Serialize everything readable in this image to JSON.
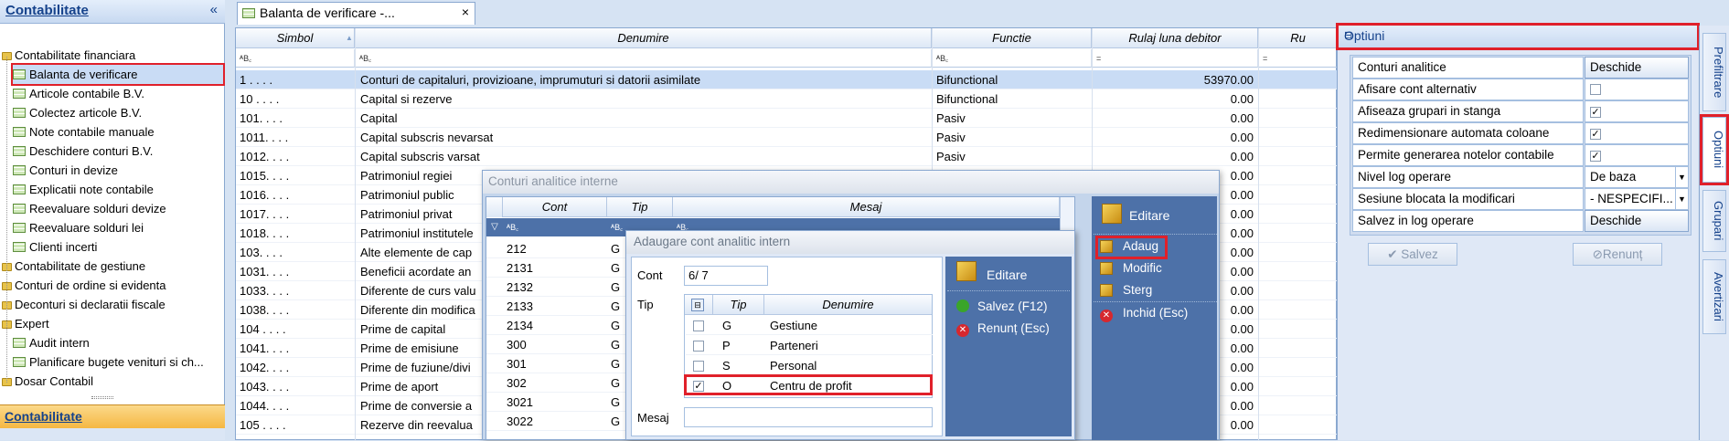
{
  "left_panel": {
    "title": "Contabilitate",
    "collapse": "«",
    "tree": [
      {
        "label": "Contabilitate financiara",
        "level": 0,
        "type": "folder"
      },
      {
        "label": "Balanta de verificare",
        "level": 1,
        "type": "grid",
        "selected": true
      },
      {
        "label": "Articole contabile B.V.",
        "level": 1,
        "type": "grid"
      },
      {
        "label": "Colectez articole B.V.",
        "level": 1,
        "type": "grid"
      },
      {
        "label": "Note contabile manuale",
        "level": 1,
        "type": "grid"
      },
      {
        "label": "Deschidere conturi B.V.",
        "level": 1,
        "type": "grid"
      },
      {
        "label": "Conturi in devize",
        "level": 1,
        "type": "grid"
      },
      {
        "label": "Explicatii  note contabile",
        "level": 1,
        "type": "grid"
      },
      {
        "label": "Reevaluare solduri devize",
        "level": 1,
        "type": "grid"
      },
      {
        "label": "Reevaluare solduri lei",
        "level": 1,
        "type": "grid"
      },
      {
        "label": "Clienti incerti",
        "level": 1,
        "type": "grid"
      },
      {
        "label": "Contabilitate de gestiune",
        "level": 0,
        "type": "folder"
      },
      {
        "label": "Conturi de ordine si evidenta",
        "level": 0,
        "type": "folder"
      },
      {
        "label": "Deconturi si declaratii fiscale",
        "level": 0,
        "type": "folder"
      },
      {
        "label": "Expert",
        "level": 0,
        "type": "folder"
      },
      {
        "label": "Audit intern",
        "level": 1,
        "type": "grid"
      },
      {
        "label": "Planificare bugete venituri si ch...",
        "level": 1,
        "type": "grid"
      },
      {
        "label": "Dosar Contabil",
        "level": 0,
        "type": "folder"
      }
    ],
    "bottom_section": "Contabilitate"
  },
  "tab": {
    "label": "Balanta de verificare -...",
    "close": "×"
  },
  "grid": {
    "columns": [
      {
        "label": "Simbol"
      },
      {
        "label": "Denumire"
      },
      {
        "label": "Functie"
      },
      {
        "label": "Rulaj luna debitor"
      },
      {
        "label": "Ru"
      }
    ],
    "filter_symbols": [
      "ᴬB꜀",
      "ᴬB꜀",
      "ᴬB꜀",
      "=",
      "="
    ],
    "rows": [
      {
        "simbol": "1  . . . .",
        "denumire": "Conturi de capitaluri, provizioane, imprumuturi si datorii asimilate",
        "functie": "Bifunctional",
        "rulaj": "53970.00",
        "selected": true
      },
      {
        "simbol": "10  . . . .",
        "denumire": "Capital si rezerve",
        "functie": "Bifunctional",
        "rulaj": "0.00"
      },
      {
        "simbol": "101. . . .",
        "denumire": "Capital",
        "functie": "Pasiv",
        "rulaj": "0.00"
      },
      {
        "simbol": "1011. . . .",
        "denumire": "Capital subscris nevarsat",
        "functie": "Pasiv",
        "rulaj": "0.00"
      },
      {
        "simbol": "1012. . . .",
        "denumire": "Capital subscris varsat",
        "functie": "Pasiv",
        "rulaj": "0.00"
      },
      {
        "simbol": "1015. . . .",
        "denumire": "Patrimoniul regiei",
        "functie": "",
        "rulaj": "0.00"
      },
      {
        "simbol": "1016. . . .",
        "denumire": "Patrimoniul public",
        "functie": "",
        "rulaj": "0.00"
      },
      {
        "simbol": "1017. . . .",
        "denumire": "Patrimoniul privat",
        "functie": "",
        "rulaj": "0.00"
      },
      {
        "simbol": "1018. . . .",
        "denumire": "Patrimoniul institutele",
        "functie": "",
        "rulaj": "0.00"
      },
      {
        "simbol": "103. . . .",
        "denumire": "Alte elemente de cap",
        "functie": "",
        "rulaj": "0.00"
      },
      {
        "simbol": "1031. . . .",
        "denumire": "Beneficii acordate an",
        "functie": "",
        "rulaj": "0.00"
      },
      {
        "simbol": "1033. . . .",
        "denumire": "Diferente de curs valu",
        "functie": "",
        "rulaj": "0.00"
      },
      {
        "simbol": "1038. . . .",
        "denumire": "Diferente din modifica",
        "functie": "",
        "rulaj": "0.00"
      },
      {
        "simbol": "104 . . . .",
        "denumire": "Prime de capital",
        "functie": "",
        "rulaj": "0.00"
      },
      {
        "simbol": "1041. . . .",
        "denumire": "Prime de emisiune",
        "functie": "",
        "rulaj": "0.00"
      },
      {
        "simbol": "1042. . . .",
        "denumire": "Prime de fuziune/divi",
        "functie": "",
        "rulaj": "0.00"
      },
      {
        "simbol": "1043. . . .",
        "denumire": "Prime de aport",
        "functie": "",
        "rulaj": "0.00"
      },
      {
        "simbol": "1044. . . .",
        "denumire": "Prime de conversie a",
        "functie": "",
        "rulaj": "0.00"
      },
      {
        "simbol": "105 . . . .",
        "denumire": "Rezerve din reevalua",
        "functie": "",
        "rulaj": "0.00"
      }
    ]
  },
  "options": {
    "title": "Optiuni",
    "rows": [
      {
        "label": "Conturi analitice",
        "type": "button",
        "value": "Deschide"
      },
      {
        "label": "Afisare cont alternativ",
        "type": "check",
        "checked": false
      },
      {
        "label": "Afiseaza grupari in stanga",
        "type": "check",
        "checked": true
      },
      {
        "label": "Redimensionare automata coloane",
        "type": "check",
        "checked": true
      },
      {
        "label": "Permite generarea notelor contabile",
        "type": "check",
        "checked": true
      },
      {
        "label": "Nivel log operare",
        "type": "select",
        "value": "De baza"
      },
      {
        "label": "Sesiune blocata la modificari",
        "type": "select",
        "value": "- NESPECIFI..."
      },
      {
        "label": "Salvez in log operare",
        "type": "button",
        "value": "Deschide"
      }
    ],
    "save_label": "Salvez",
    "cancel_label": "Renunț"
  },
  "side_tabs": [
    "Prefiltrare",
    "Optiuni",
    "Grupari",
    "Avertizari"
  ],
  "dialog_conturi": {
    "title": "Conturi analitice interne",
    "columns": [
      "Cont",
      "Tip",
      "Mesaj"
    ],
    "rows": [
      {
        "cont": "212",
        "tip": "G"
      },
      {
        "cont": "2131",
        "tip": "G"
      },
      {
        "cont": "2132",
        "tip": "G"
      },
      {
        "cont": "2133",
        "tip": "G"
      },
      {
        "cont": "2134",
        "tip": "G"
      },
      {
        "cont": "300",
        "tip": "G"
      },
      {
        "cont": "301",
        "tip": "G"
      },
      {
        "cont": "302",
        "tip": "G"
      },
      {
        "cont": "3021",
        "tip": "G"
      },
      {
        "cont": "3022",
        "tip": "G"
      }
    ],
    "side": {
      "title": "Editare",
      "add": "Adaug",
      "modify": "Modific",
      "delete": "Sterg",
      "close": "Inchid (Esc)"
    }
  },
  "dialog_adaugare": {
    "title": "Adaugare cont analitic intern",
    "cont_label": "Cont",
    "cont_value": "6/ 7",
    "tip_label": "Tip",
    "tip_columns": [
      "Tip",
      "Denumire"
    ],
    "tip_rows": [
      {
        "tip": "G",
        "denumire": "Gestiune",
        "checked": false
      },
      {
        "tip": "P",
        "denumire": "Parteneri",
        "checked": false
      },
      {
        "tip": "S",
        "denumire": "Personal",
        "checked": false
      },
      {
        "tip": "O",
        "denumire": "Centru de profit",
        "checked": true
      }
    ],
    "mesaj_label": "Mesaj",
    "side": {
      "title": "Editare",
      "save": "Salvez (F12)",
      "cancel": "Renunț (Esc)"
    }
  }
}
